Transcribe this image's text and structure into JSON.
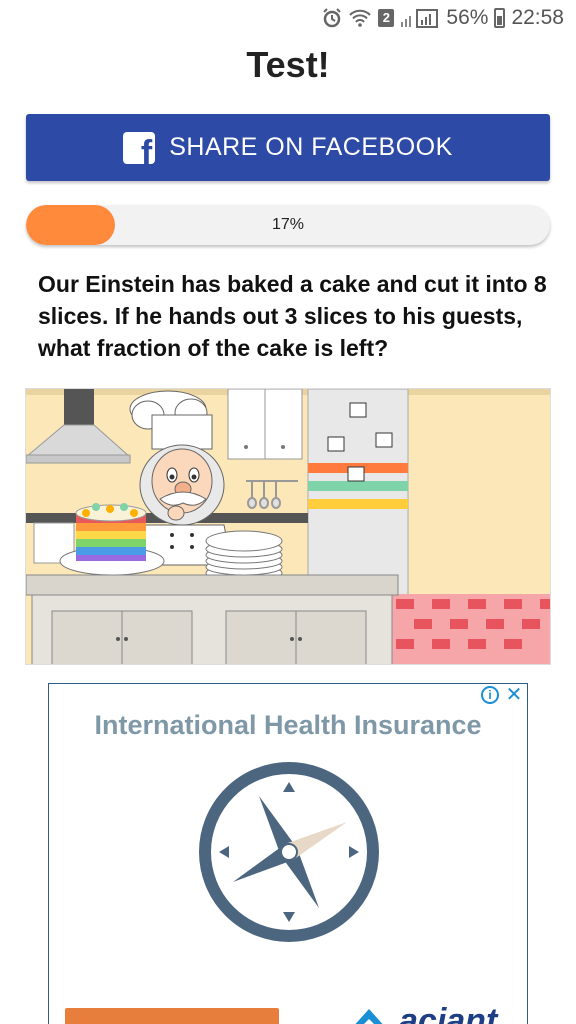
{
  "status_bar": {
    "sim_slot": "2",
    "battery": "56%",
    "time": "22:58",
    "icons": [
      "alarm-icon",
      "wifi-icon",
      "signal-icon",
      "battery-icon"
    ]
  },
  "page": {
    "title": "Test!"
  },
  "share": {
    "label": "SHARE ON FACEBOOK",
    "icon": "facebook-icon",
    "color": "#2d4aa6"
  },
  "progress": {
    "label": "17%",
    "value": 0.17,
    "fill_color": "#ff8a3c"
  },
  "question": {
    "text": "Our Einstein has baked a cake and cut it into 8 slices. If he hands out 3 slices to his guests, what fraction of the cake is left?"
  },
  "illustration": {
    "subject": "chef-with-cake-illustration"
  },
  "ad": {
    "title": "International Health Insurance",
    "brand": "aciant",
    "info_icon": "info-icon",
    "close_icon": "close-icon",
    "accent_color": "#e87e3c"
  }
}
